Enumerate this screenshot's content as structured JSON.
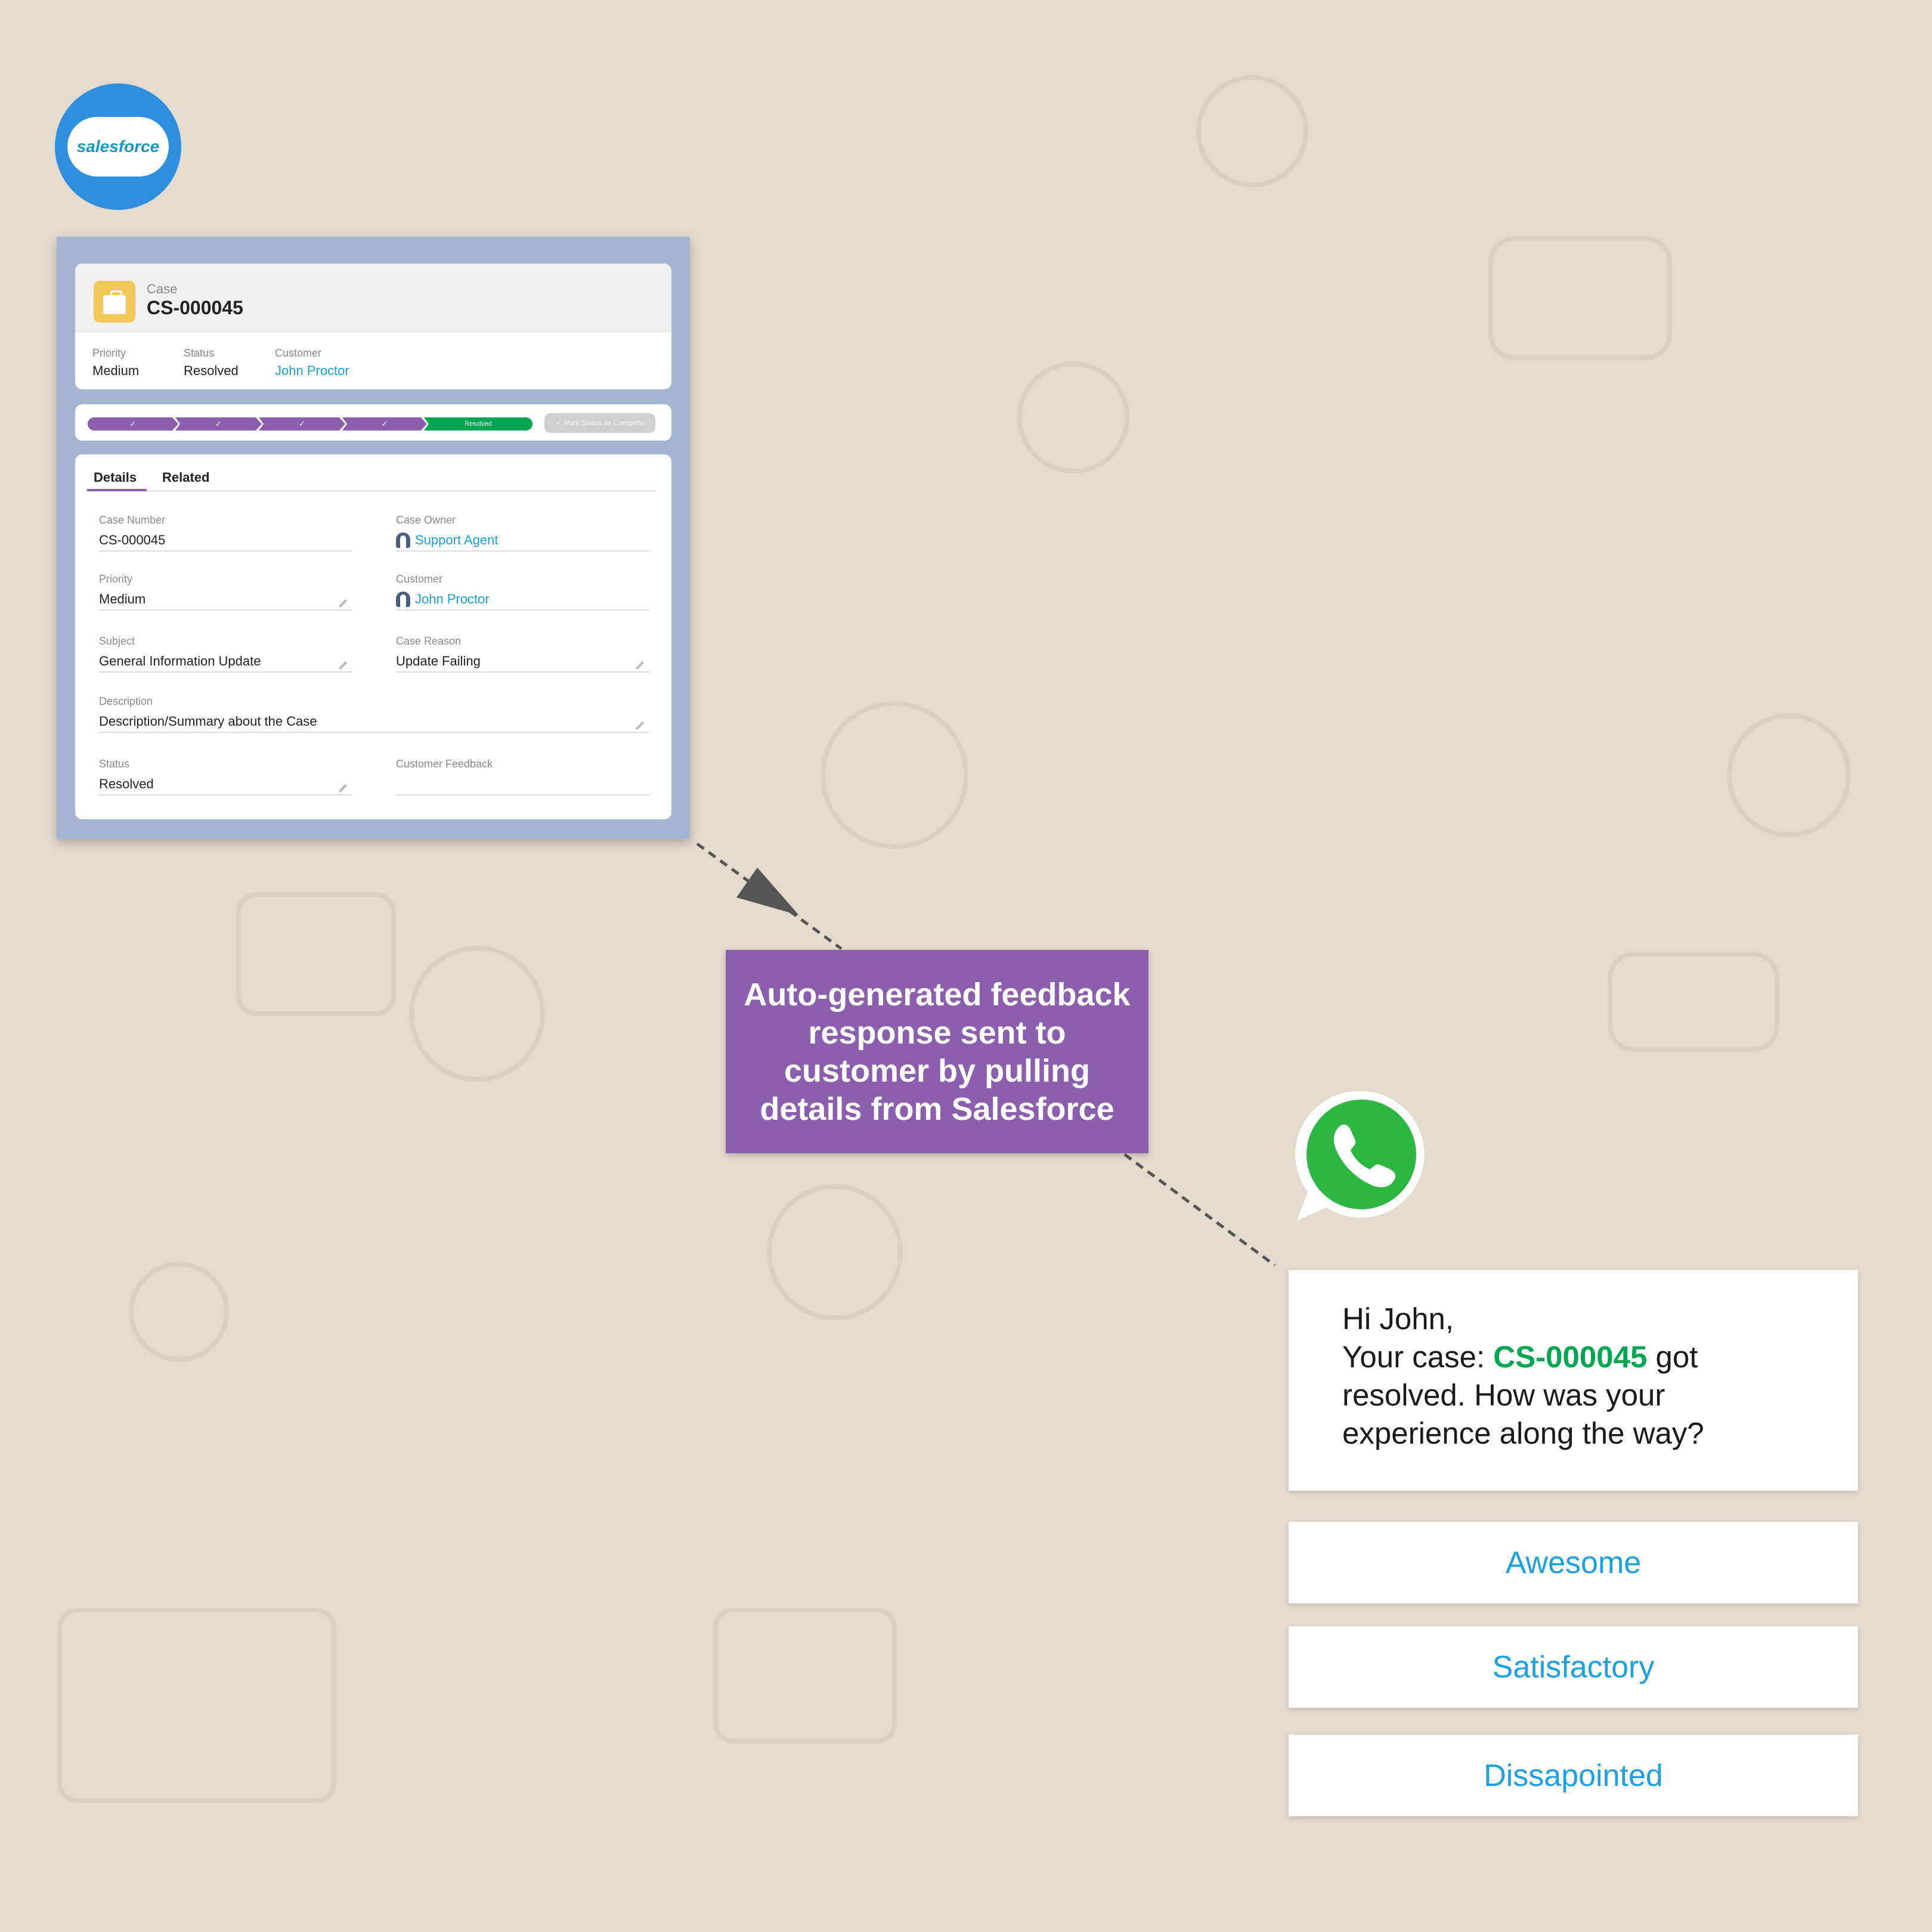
{
  "logo": {
    "text": "salesforce",
    "color": "#2e8fdf"
  },
  "case_header": {
    "object_label": "Case",
    "case_number": "CS-000045",
    "highlights": [
      {
        "label": "Priority",
        "value": "Medium"
      },
      {
        "label": "Status",
        "value": "Resolved"
      },
      {
        "label": "Customer",
        "value": "John Proctor"
      }
    ]
  },
  "path": {
    "steps": [
      "✓",
      "✓",
      "✓",
      "✓",
      "Resolved"
    ],
    "current": "Resolved",
    "mark_button": "✓ Mark Status as Complete"
  },
  "tabs": {
    "details": "Details",
    "related": "Related",
    "active": "Details"
  },
  "fields": {
    "case_number": {
      "label": "Case Number",
      "value": "CS-000045"
    },
    "case_owner": {
      "label": "Case Owner",
      "value": "Support Agent"
    },
    "priority": {
      "label": "Priority",
      "value": "Medium"
    },
    "customer": {
      "label": "Customer",
      "value": "John Proctor"
    },
    "subject": {
      "label": "Subject",
      "value": "General Information Update"
    },
    "case_reason": {
      "label": "Case Reason",
      "value": "Update Failing"
    },
    "description": {
      "label": "Description",
      "value": "Description/Summary about the Case"
    },
    "status": {
      "label": "Status",
      "value": "Resolved"
    },
    "customer_feedback": {
      "label": "Customer Feedback",
      "value": ""
    }
  },
  "callout": {
    "text": "Auto-generated feedback response sent to customer by pulling details from Salesforce",
    "color": "#8a5fad"
  },
  "message": {
    "greeting": "Hi John,",
    "line_prefix": "Your case: ",
    "case_number": "CS-000045",
    "line_suffix": " got resolved. How was your experience along the way?"
  },
  "options": [
    "Awesome",
    "Satisfactory",
    "Dissapointed"
  ],
  "colors": {
    "accent_purple": "#8a5fad",
    "success_green": "#00a651",
    "link_blue": "#1ba1e2",
    "whatsapp_green": "#25d366"
  }
}
